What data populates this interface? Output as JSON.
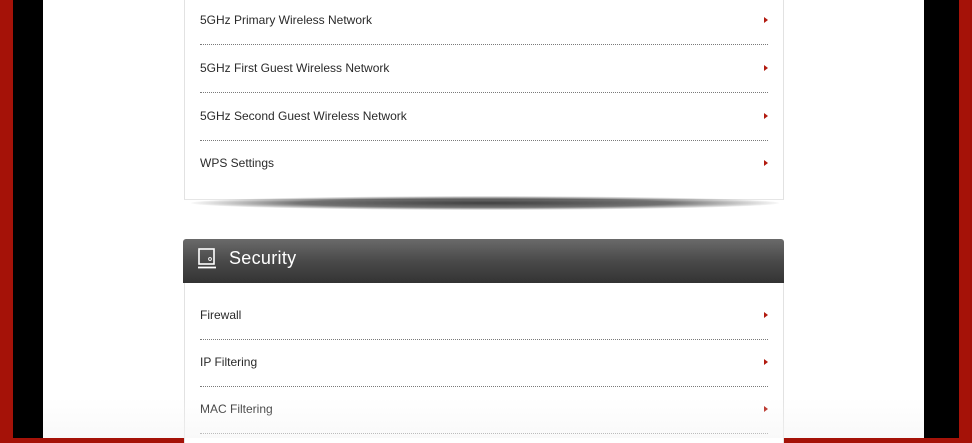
{
  "wireless_menu": {
    "items": [
      {
        "label": "5GHz Primary Wireless Network"
      },
      {
        "label": "5GHz First Guest Wireless Network"
      },
      {
        "label": "5GHz Second Guest Wireless Network"
      },
      {
        "label": "WPS Settings"
      }
    ]
  },
  "security": {
    "title": "Security",
    "icon": "monitor-icon",
    "items": [
      {
        "label": "Firewall"
      },
      {
        "label": "IP Filtering"
      },
      {
        "label": "MAC Filtering"
      }
    ]
  },
  "colors": {
    "frame_red": "#a51208",
    "arrow_red": "#b21b10",
    "header_gray": "#4a4a4a"
  }
}
